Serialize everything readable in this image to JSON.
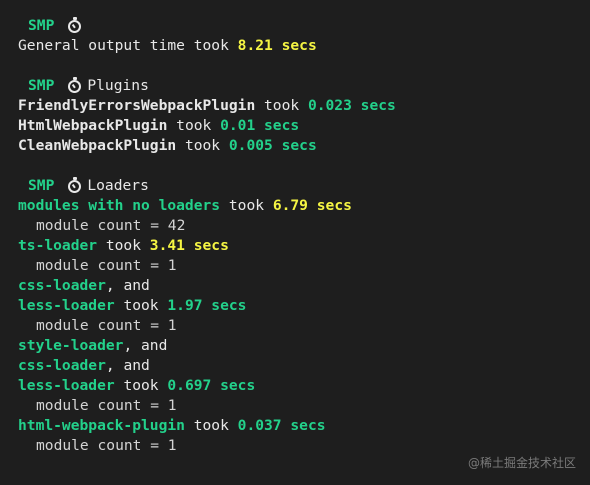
{
  "sections": {
    "general": {
      "tag": "SMP",
      "icon": "stopwatch-icon",
      "prefix": "General output time took ",
      "time": "8.21 secs"
    },
    "plugins": {
      "tag": "SMP",
      "icon": "stopwatch-icon",
      "title": "Plugins",
      "items": [
        {
          "name": "FriendlyErrorsWebpackPlugin",
          "took": " took ",
          "time": "0.023 secs"
        },
        {
          "name": "HtmlWebpackPlugin",
          "took": " took ",
          "time": "0.01 secs"
        },
        {
          "name": "CleanWebpackPlugin",
          "took": " took ",
          "time": "0.005 secs"
        }
      ]
    },
    "loaders": {
      "tag": "SMP",
      "icon": "stopwatch-icon",
      "title": "Loaders",
      "l0": {
        "name": "modules with no loaders",
        "took": " took ",
        "time": "6.79 secs",
        "count": "module count = 42"
      },
      "l1": {
        "name": "ts-loader",
        "took": " took ",
        "time": "3.41 secs",
        "count": "module count = 1"
      },
      "l2": {
        "a": "css-loader",
        "and": ", and",
        "b": "less-loader",
        "took": " took ",
        "time": "1.97 secs",
        "count": "module count = 1"
      },
      "l3": {
        "a": "style-loader",
        "and1": ", and",
        "b": "css-loader",
        "and2": ", and",
        "c": "less-loader",
        "took": " took ",
        "time": "0.697 secs",
        "count": "module count = 1"
      },
      "l4": {
        "name": "html-webpack-plugin",
        "took": " took ",
        "time": "0.037 secs",
        "count": "module count = 1"
      }
    }
  },
  "watermark": "@稀土掘金技术社区",
  "colors": {
    "background": "#1e1e1e",
    "green": "#23d18b",
    "yellow": "#f5f543",
    "text": "#d4d4d4"
  }
}
